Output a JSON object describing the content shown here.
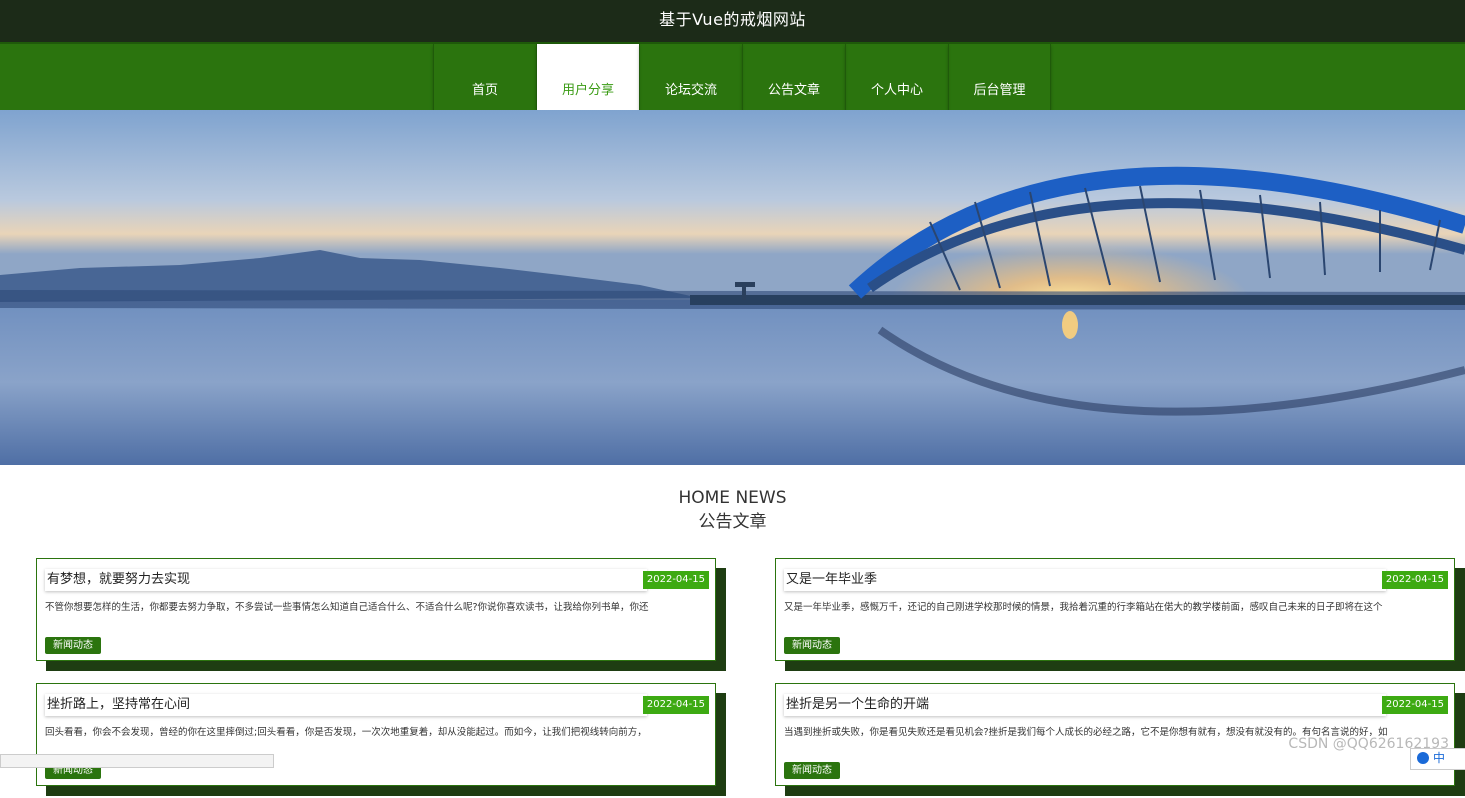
{
  "header": {
    "site_title": "基于Vue的戒烟网站"
  },
  "nav": {
    "items": [
      {
        "label": "首页"
      },
      {
        "label": "用户分享"
      },
      {
        "label": "论坛交流"
      },
      {
        "label": "公告文章"
      },
      {
        "label": "个人中心"
      },
      {
        "label": "后台管理"
      }
    ],
    "active_index": 1
  },
  "carousel": {
    "slide_count": 3,
    "active_slide": 1
  },
  "section": {
    "title_en": "HOME NEWS",
    "title_cn": "公告文章"
  },
  "articles": [
    {
      "title": "有梦想，就要努力去实现",
      "date": "2022-04-15",
      "desc": "不管你想要怎样的生活，你都要去努力争取，不多尝试一些事情怎么知道自己适合什么、不适合什么呢?你说你喜欢读书，让我给你列书单，你还",
      "tag": "新闻动态"
    },
    {
      "title": "又是一年毕业季",
      "date": "2022-04-15",
      "desc": "又是一年毕业季，感慨万千，还记的自己刚进学校那时候的情景，我拾着沉重的行李箱站在偌大的教学楼前面，感叹自己未来的日子即将在这个",
      "tag": "新闻动态"
    },
    {
      "title": "挫折路上，坚持常在心间",
      "date": "2022-04-15",
      "desc": "回头看看，你会不会发现，曾经的你在这里摔倒过;回头看看，你是否发现，一次次地重复着，却从没能起过。而如今，让我们把视线转向前方，",
      "tag": "新闻动态"
    },
    {
      "title": "挫折是另一个生命的开端",
      "date": "2022-04-15",
      "desc": "当遇到挫折或失败，你是看见失败还是看见机会?挫折是我们每个人成长的必经之路，它不是你想有就有，想没有就没有的。有句名言说的好，如",
      "tag": "新闻动态"
    }
  ],
  "watermark": "CSDN @QQ626162193",
  "ime": "中",
  "colors": {
    "topbar": "#1c2b18",
    "nav": "#2b740e",
    "accent": "#3daa12",
    "shadow": "#1e3d12"
  }
}
